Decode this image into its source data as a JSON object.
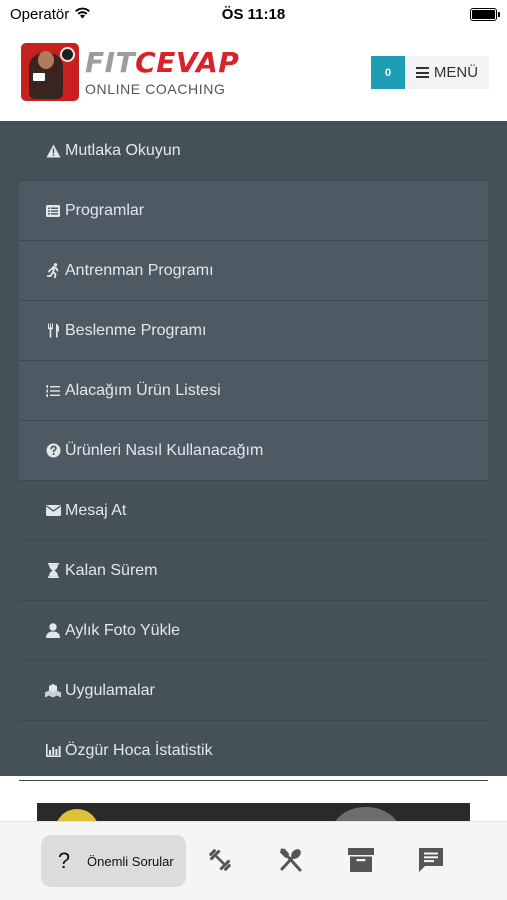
{
  "status_bar": {
    "carrier": "Operatör",
    "time": "ÖS 11:18"
  },
  "header": {
    "logo_title_part1": "FIT",
    "logo_title_part2": "CEVAP",
    "logo_subtitle": "ONLINE COACHING",
    "brand_colors": {
      "fit": "#9d9d9d",
      "cevap": "#d8232a"
    },
    "cart_count": "0",
    "cart_color": "#1f9db5",
    "menu_label": "MENÜ"
  },
  "menu": {
    "background": "#455159",
    "items": [
      {
        "label": "Mutlaka Okuyun",
        "icon": "warning-icon",
        "submenu": false
      },
      {
        "label": "Programlar",
        "icon": "list-icon",
        "submenu": true
      },
      {
        "label": "Antrenman Programı",
        "icon": "running-icon",
        "submenu": true
      },
      {
        "label": "Beslenme Programı",
        "icon": "utensils-icon",
        "submenu": true
      },
      {
        "label": "Alacağım Ürün Listesi",
        "icon": "ordered-list-icon",
        "submenu": true
      },
      {
        "label": "Ürünleri Nasıl Kullanacağım",
        "icon": "question-circle-icon",
        "submenu": true
      },
      {
        "label": "Mesaj At",
        "icon": "envelope-icon",
        "submenu": false
      },
      {
        "label": "Kalan Sürem",
        "icon": "hourglass-icon",
        "submenu": false
      },
      {
        "label": "Aylık Foto Yükle",
        "icon": "user-icon",
        "submenu": false
      },
      {
        "label": "Uygulamalar",
        "icon": "cubes-icon",
        "submenu": false
      },
      {
        "label": "Özgür Hoca İstatistik",
        "icon": "chart-icon",
        "submenu": false
      }
    ]
  },
  "tab_bar": {
    "active_label": "Önemli Sorular",
    "active_icon": "question-mark-icon",
    "tabs": [
      {
        "icon": "dumbbell-icon"
      },
      {
        "icon": "fork-spoon-icon"
      },
      {
        "icon": "archive-icon"
      },
      {
        "icon": "message-icon"
      }
    ]
  }
}
